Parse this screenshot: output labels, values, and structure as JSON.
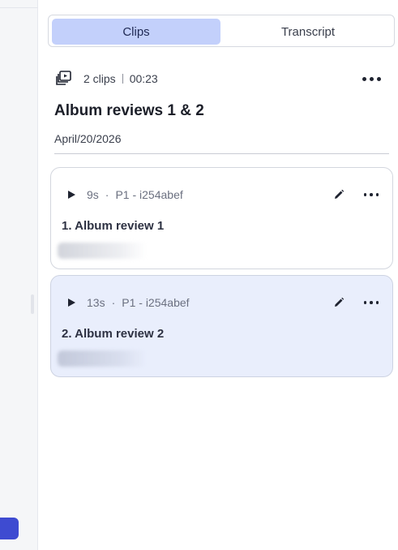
{
  "tabs": {
    "clips": "Clips",
    "transcript": "Transcript",
    "active": "clips"
  },
  "header": {
    "clip_count": "2 clips",
    "duration": "00:23",
    "title": "Album reviews 1 & 2",
    "date": "April/20/2026"
  },
  "clips": [
    {
      "duration": "9s",
      "participant": "P1 - i254abef",
      "title": "1. Album review 1",
      "selected": false
    },
    {
      "duration": "13s",
      "participant": "P1 - i254abef",
      "title": "2. Album review 2",
      "selected": true
    }
  ],
  "icons": {
    "clips": "stacked-clips-icon",
    "more": "more-dots-icon",
    "play": "play-icon",
    "edit": "pencil-icon"
  },
  "colors": {
    "accent_tab": "#c3d0fb",
    "selected_card": "#e9eefc",
    "rail_button": "#3e4bd1"
  }
}
